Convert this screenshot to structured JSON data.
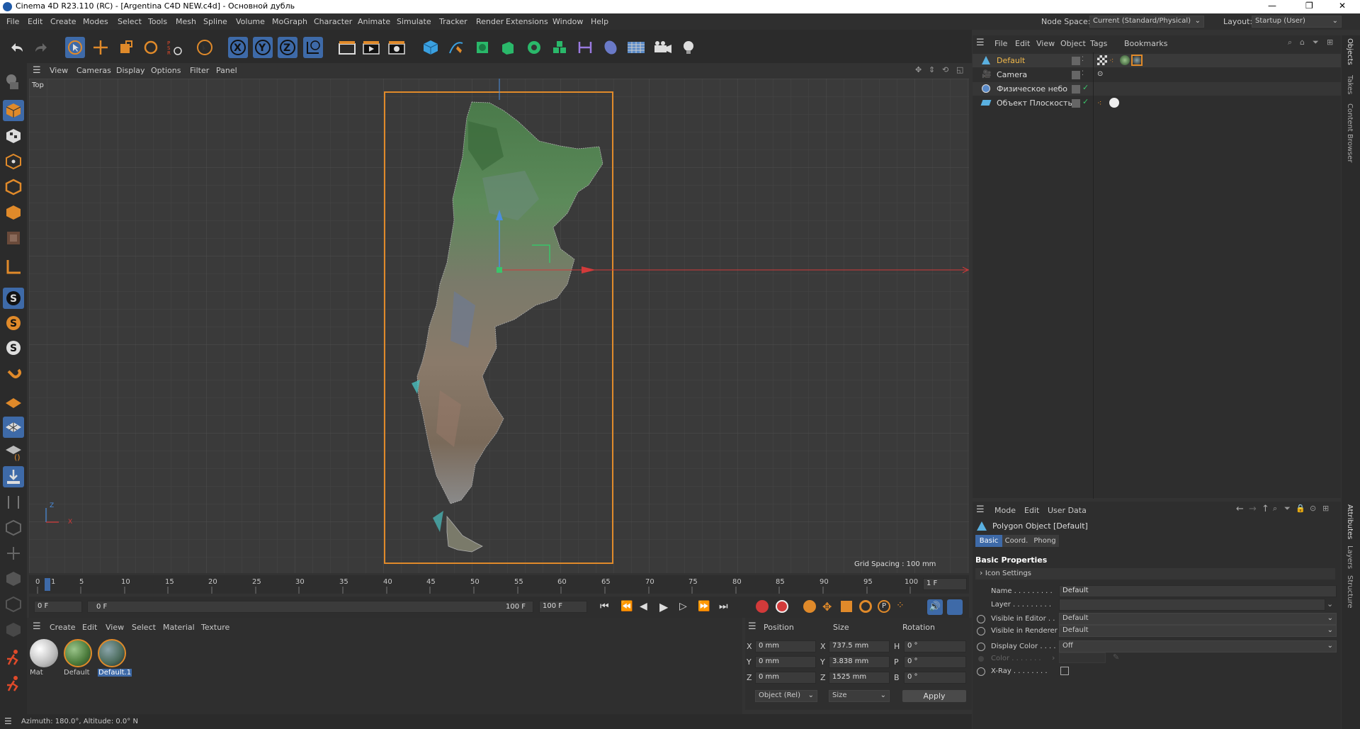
{
  "titlebar": {
    "title": "Cinema 4D R23.110 (RC) - [Argentina C4D NEW.c4d] - Основной дубль",
    "min": "—",
    "max": "❐",
    "close": "✕"
  },
  "menubar": {
    "items": [
      "File",
      "Edit",
      "Create",
      "Modes",
      "Select",
      "Tools",
      "Mesh",
      "Spline",
      "Volume",
      "MoGraph",
      "Character",
      "Animate",
      "Simulate",
      "Tracker",
      "Render",
      "Extensions",
      "Window",
      "Help"
    ],
    "node_space_label": "Node Space:",
    "node_space_value": "Current (Standard/Physical)",
    "layout_label": "Layout:",
    "layout_value": "Startup (User)"
  },
  "viewport_menu": {
    "items": [
      "View",
      "Cameras",
      "Display",
      "Options",
      "Filter",
      "Panel"
    ],
    "view_name": "Top",
    "grid_spacing": "Grid Spacing : 100 mm",
    "axis_z": "Z",
    "axis_x": "X"
  },
  "timeline": {
    "ticks": [
      "0",
      "1",
      "5",
      "10",
      "15",
      "20",
      "25",
      "30",
      "35",
      "40",
      "45",
      "50",
      "55",
      "60",
      "65",
      "70",
      "75",
      "80",
      "85",
      "90",
      "95",
      "100"
    ],
    "current_frame": "1 F"
  },
  "playbar": {
    "start": "0 F",
    "range_start": "0 F",
    "range_end": "100 F",
    "end": "100 F"
  },
  "material_manager": {
    "menu": [
      "Create",
      "Edit",
      "View",
      "Select",
      "Material",
      "Texture"
    ],
    "materials": [
      {
        "name": "Mat",
        "type": "white"
      },
      {
        "name": "Default",
        "type": "earth"
      },
      {
        "name": "Default.1",
        "type": "earth2"
      }
    ]
  },
  "coord_manager": {
    "headers": [
      "Position",
      "Size",
      "Rotation"
    ],
    "rows": [
      {
        "axis": "X",
        "pos": "0 mm",
        "saxis": "X",
        "size": "737.5 mm",
        "raxis": "H",
        "rot": "0 °"
      },
      {
        "axis": "Y",
        "pos": "0 mm",
        "saxis": "Y",
        "size": "3.838 mm",
        "raxis": "P",
        "rot": "0 °"
      },
      {
        "axis": "Z",
        "pos": "0 mm",
        "saxis": "Z",
        "size": "1525 mm",
        "raxis": "B",
        "rot": "0 °"
      }
    ],
    "mode": "Object (Rel)",
    "size_mode": "Size",
    "apply": "Apply"
  },
  "statusbar": {
    "text": "Azimuth: 180.0°, Altitude: 0.0°  N"
  },
  "object_manager": {
    "menu": [
      "File",
      "Edit",
      "View",
      "Object",
      "Tags",
      "Bookmarks"
    ],
    "objects": [
      {
        "name": "Default",
        "selected": true
      },
      {
        "name": "Camera",
        "selected": false
      },
      {
        "name": "Физическое небо",
        "selected": false
      },
      {
        "name": "Объект Плоскость",
        "selected": false
      }
    ]
  },
  "attribute_manager": {
    "menu": [
      "Mode",
      "Edit",
      "User Data"
    ],
    "object_title": "Polygon Object [Default]",
    "tabs": [
      "Basic",
      "Coord.",
      "Phong"
    ],
    "section": "Basic Properties",
    "icon_settings": "Icon Settings",
    "fields": {
      "name_label": "Name . . . . . . . . .",
      "name_value": "Default",
      "layer_label": "Layer . . . . . . . . .",
      "visible_editor_label": "Visible in Editor . .",
      "visible_editor_value": "Default",
      "visible_renderer_label": "Visible in Renderer",
      "visible_renderer_value": "Default",
      "display_color_label": "Display Color . . . .",
      "display_color_value": "Off",
      "color_label": "Color . . . . . . .",
      "xray_label": "X-Ray . . . . . . . ."
    }
  },
  "right_strip": {
    "tabs": [
      "Objects",
      "Takes",
      "Content Browser",
      "Attributes",
      "Layers",
      "Structure"
    ]
  },
  "colors": {
    "accent": "#3e6aa8",
    "selection_orange": "#e08a2a",
    "axis_red": "#d23a3a",
    "axis_green": "#3ac46a",
    "axis_blue": "#4a8ee0"
  }
}
